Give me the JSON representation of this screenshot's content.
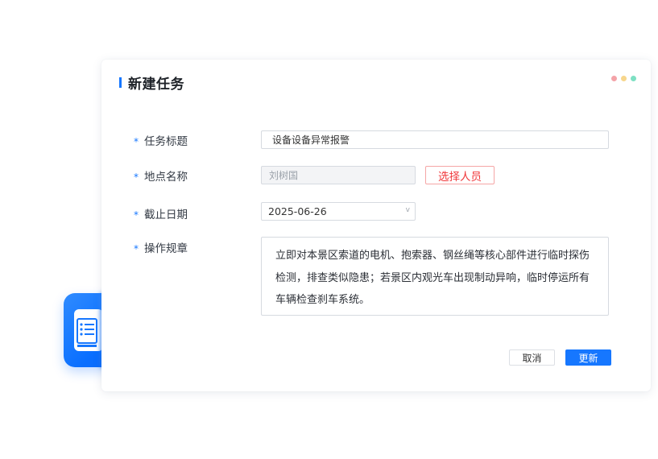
{
  "dialog": {
    "title": "新建任务",
    "window_dots": [
      "red",
      "yellow",
      "green"
    ]
  },
  "form": {
    "required_mark": "*",
    "fields": [
      {
        "label": "任务标题",
        "value": "设备设备异常报警"
      },
      {
        "label": "地点名称",
        "value": "刘树国",
        "action_label": "选择人员"
      },
      {
        "label": "截止日期",
        "value": "2025-06-26"
      },
      {
        "label": "操作规章",
        "value": "立即对本景区索道的电机、抱索器、钢丝绳等核心部件进行临时探伤检测，排查类似隐患；若景区内观光车出现制动异响，临时停运所有车辆检查刹车系统。"
      }
    ]
  },
  "buttons": {
    "cancel": "取消",
    "submit": "更新"
  },
  "colors": {
    "accent": "#1677ff",
    "danger": "#f0383b"
  },
  "icons": {
    "app_badge": "checklist-document-icon",
    "date_dropdown": "chevron-down-icon"
  }
}
